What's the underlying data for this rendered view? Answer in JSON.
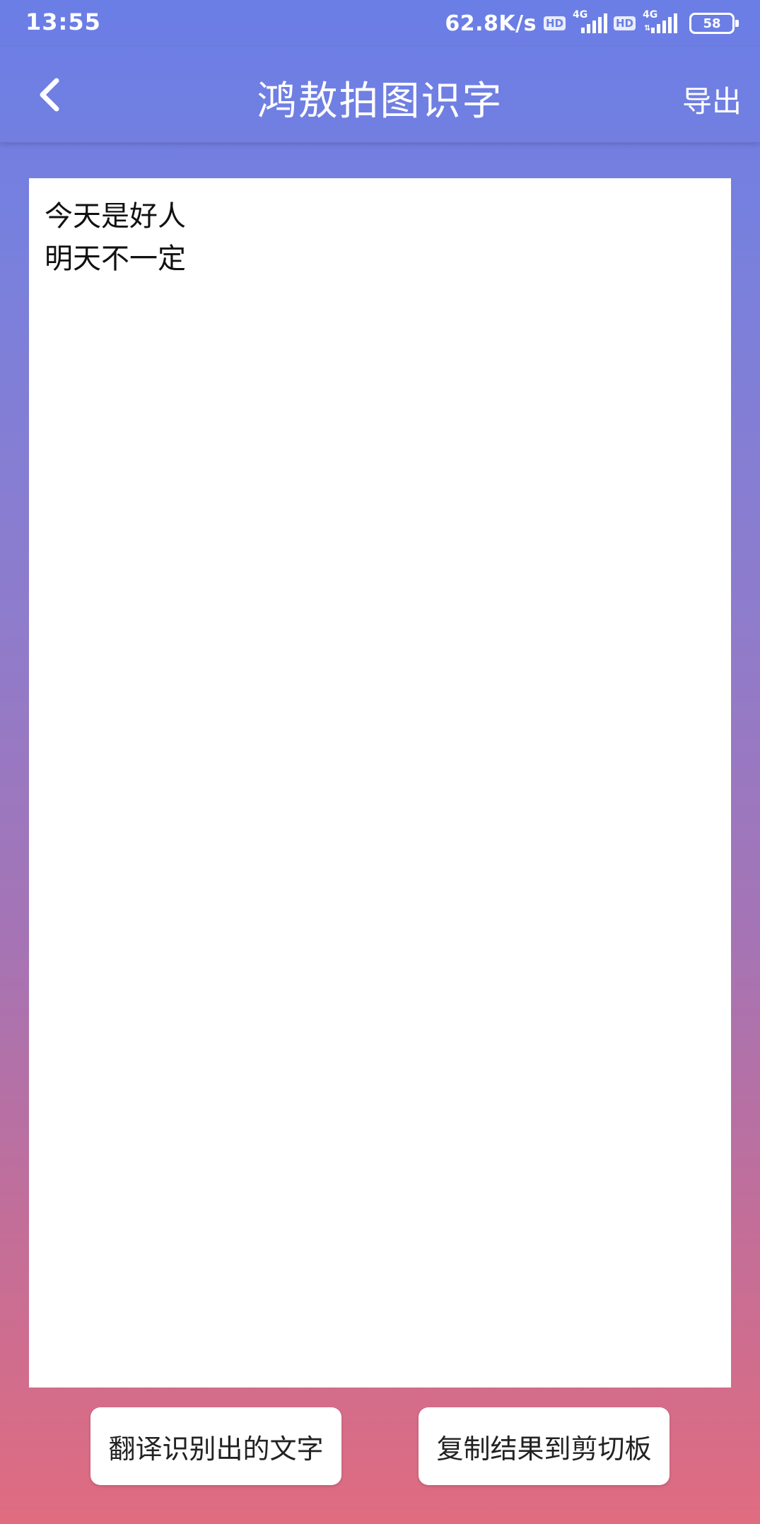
{
  "status_bar": {
    "time": "13:55",
    "net_speed": "62.8K/s",
    "hd_badge": "HD",
    "network_type": "4G",
    "battery": "58"
  },
  "header": {
    "title": "鸿敖拍图识字",
    "back_icon": "chevron-left-icon",
    "export_label": "导出"
  },
  "result": {
    "text": "今天是好人\n明天不一定"
  },
  "actions": {
    "translate_label": "翻译识别出的文字",
    "copy_label": "复制结果到剪切板"
  },
  "colors": {
    "gradient_top": "#6a7ee6",
    "gradient_bottom": "#e06c80",
    "panel_bg": "#ffffff"
  }
}
